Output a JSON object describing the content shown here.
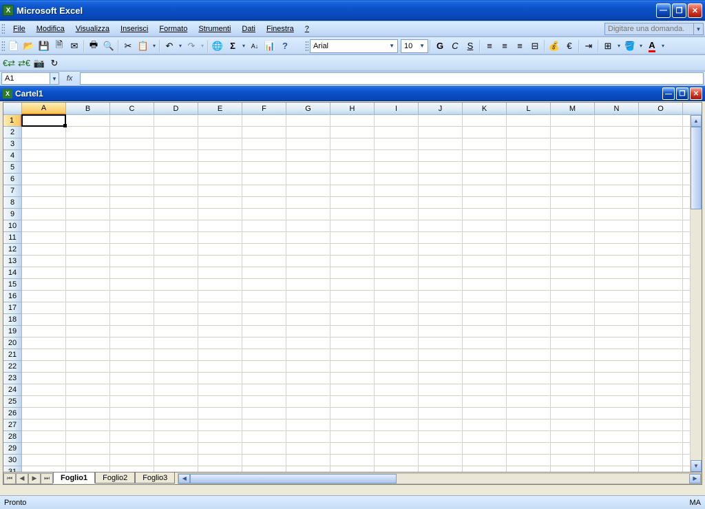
{
  "app_title": "Microsoft Excel",
  "menus": [
    "File",
    "Modifica",
    "Visualizza",
    "Inserisci",
    "Formato",
    "Strumenti",
    "Dati",
    "Finestra",
    "?"
  ],
  "help_placeholder": "Digitare una domanda.",
  "font": "Arial",
  "font_size": "10",
  "name_box": "A1",
  "fx_label": "fx",
  "workbook_title": "Cartel1",
  "columns": [
    "A",
    "B",
    "C",
    "D",
    "E",
    "F",
    "G",
    "H",
    "I",
    "J",
    "K",
    "L",
    "M",
    "N",
    "O"
  ],
  "row_count": 32,
  "sheets": [
    "Foglio1",
    "Foglio2",
    "Foglio3"
  ],
  "active_sheet": 0,
  "selected_cell": "A1",
  "status_left": "Pronto",
  "status_right": "MA",
  "format_buttons": {
    "bold": "G",
    "italic": "C",
    "underline": "S"
  },
  "currency": "€"
}
